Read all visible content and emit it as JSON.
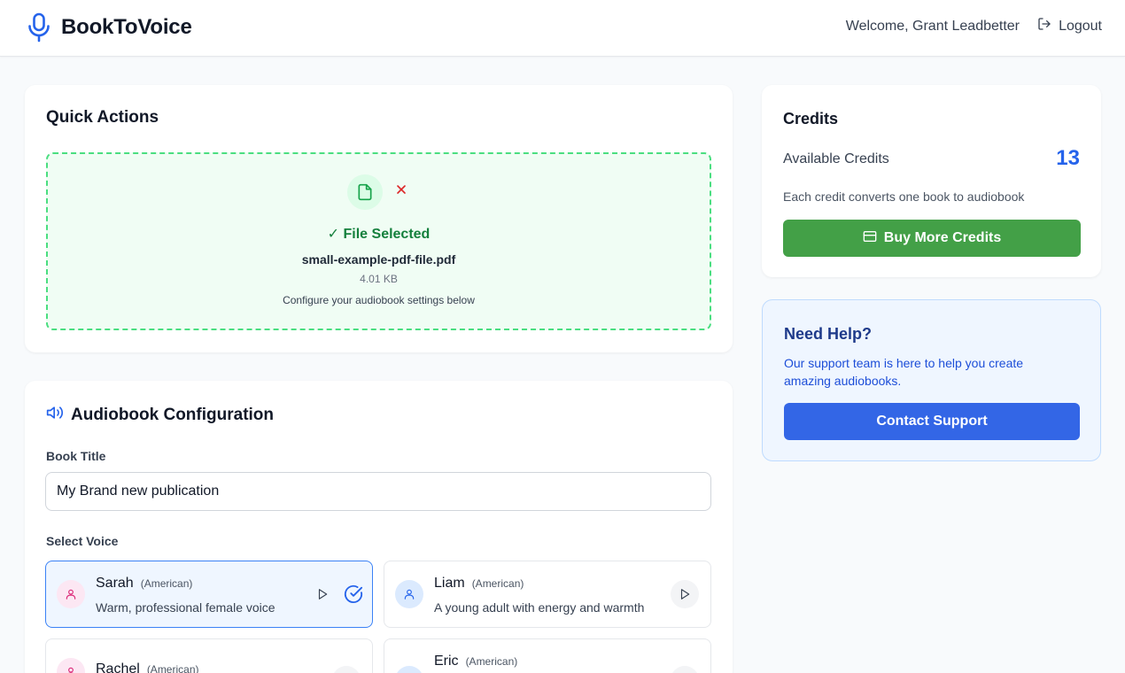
{
  "header": {
    "brand_name": "BookToVoice",
    "brand_icon": "microphone-icon",
    "welcome_text": "Welcome, Grant Leadbetter",
    "logout_label": "Logout"
  },
  "quick_actions": {
    "title": "Quick Actions",
    "file_status": "✓ File Selected",
    "file_name": "small-example-pdf-file.pdf",
    "file_size": "4.01 KB",
    "file_note": "Configure your audiobook settings below"
  },
  "config": {
    "title": "Audiobook Configuration",
    "book_title_label": "Book Title",
    "book_title_value": "My Brand new publication",
    "select_voice_label": "Select Voice",
    "voices": [
      {
        "name": "Sarah",
        "accent": "(American)",
        "description": "Warm, professional female voice",
        "selected": true
      },
      {
        "name": "Liam",
        "accent": "(American)",
        "description": "A young adult with energy and warmth",
        "selected": false
      },
      {
        "name": "Rachel",
        "accent": "(American)",
        "description": "",
        "selected": false
      },
      {
        "name": "Eric",
        "accent": "(American)",
        "description": "",
        "selected": false
      }
    ]
  },
  "credits": {
    "title": "Credits",
    "available_label": "Available Credits",
    "available_count": "13",
    "note": "Each credit converts one book to audiobook",
    "buy_label": "Buy More Credits"
  },
  "help": {
    "title": "Need Help?",
    "text": "Our support team is here to help you create amazing audiobooks.",
    "button_label": "Contact Support"
  },
  "colors": {
    "accent_blue": "#2563eb",
    "success_green": "#43a047",
    "support_blue": "#3366e6"
  }
}
